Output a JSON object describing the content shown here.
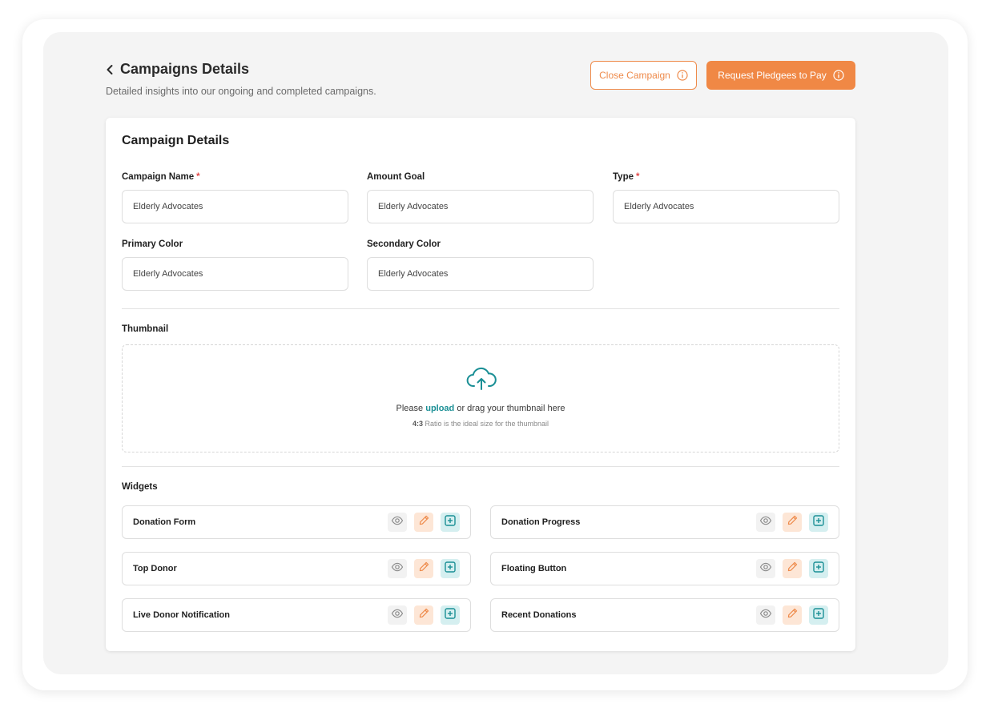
{
  "header": {
    "title": "Campaigns Details",
    "subtitle": "Detailed insights into our ongoing and completed campaigns.",
    "close_button": "Close Campaign",
    "request_button": "Request Pledgees to Pay"
  },
  "card": {
    "title": "Campaign Details",
    "fields": [
      {
        "label": "Campaign Name",
        "required": "*",
        "value": "Elderly Advocates"
      },
      {
        "label": "Amount Goal",
        "required": "",
        "value": "Elderly Advocates"
      },
      {
        "label": "Type",
        "required": "*",
        "value": "Elderly Advocates"
      },
      {
        "label": "Primary Color",
        "required": "",
        "value": "Elderly Advocates"
      },
      {
        "label": "Secondary Color",
        "required": "",
        "value": "Elderly Advocates"
      }
    ],
    "thumbnail": {
      "label": "Thumbnail",
      "text_before": "Please ",
      "link": "upload",
      "text_after": " or drag your thumbnail here",
      "ratio": "4:3",
      "ratio_text": " Ratio is the ideal size for the thumbnail"
    },
    "widgets_label": "Widgets",
    "widgets": [
      "Donation Form",
      "Donation Progress",
      "Top Donor",
      "Floating Button",
      "Live Donor Notification",
      "Recent Donations"
    ]
  },
  "colors": {
    "accent_orange": "#f08845",
    "accent_teal": "#1a8f95",
    "required_red": "#e24a4a"
  },
  "icons": {
    "back": "chevron-left-icon",
    "info": "info-icon",
    "cloud": "cloud-upload-icon",
    "view": "eye-icon",
    "edit": "pencil-icon",
    "add": "plus-square-icon"
  }
}
